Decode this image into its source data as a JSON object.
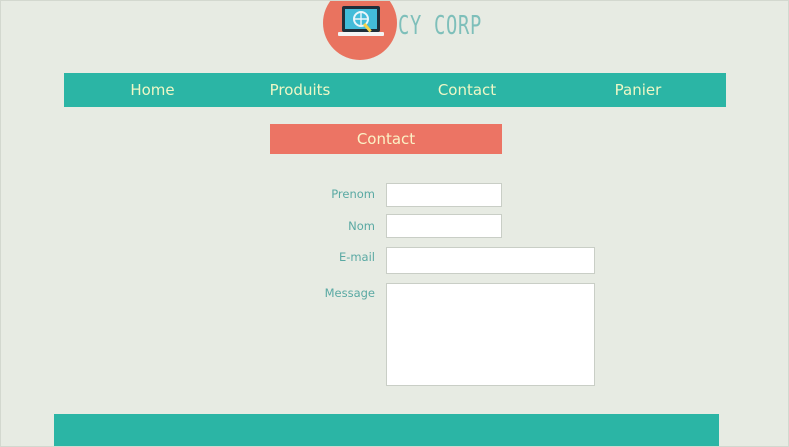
{
  "header": {
    "logo_text": "CY CORP",
    "logo_icon": "laptop-globe-icon"
  },
  "nav": {
    "items": [
      {
        "label": "Home"
      },
      {
        "label": "Produits"
      },
      {
        "label": "Contact"
      },
      {
        "label": "Panier"
      }
    ]
  },
  "main": {
    "section_title": "Contact",
    "form": {
      "prenom_label": "Prenom",
      "prenom_value": "",
      "nom_label": "Nom",
      "nom_value": "",
      "email_label": "E-mail",
      "email_value": "",
      "message_label": "Message",
      "message_value": ""
    }
  },
  "colors": {
    "background": "#e7ebe3",
    "teal": "#2bb5a5",
    "coral": "#ec7464",
    "nav_text": "#eef7c6",
    "label_text": "#5aa9a3"
  }
}
